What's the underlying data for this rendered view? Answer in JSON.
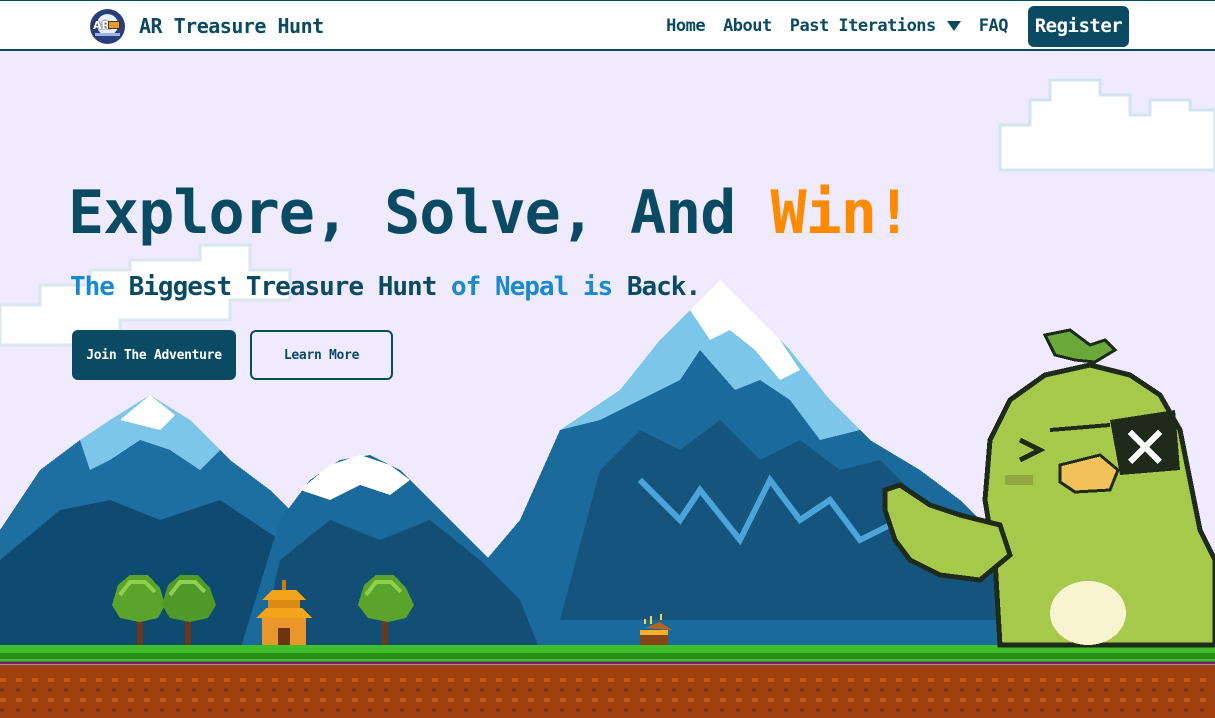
{
  "brand": {
    "name": "AR Treasure Hunt",
    "logo_text": "AR",
    "logo_icon": "treasure-chest-logo"
  },
  "nav": {
    "items": [
      {
        "label": "Home"
      },
      {
        "label": "About"
      },
      {
        "label": "Past Iterations",
        "icon": "chevron-down-icon"
      },
      {
        "label": "FAQ"
      }
    ],
    "register_label": "Register"
  },
  "hero": {
    "title_main": "Explore, Solve, And ",
    "title_accent": "Win!",
    "subtitle_parts": [
      "The",
      " Biggest Treasure Hunt ",
      "of Nepal is",
      " Back."
    ],
    "primary_button": "Join The Adventure",
    "secondary_button": "Learn More"
  },
  "colors": {
    "brand_navy": "#0a4a63",
    "accent_orange": "#ff8a00",
    "accent_blue": "#1a8ad0",
    "sky": "#efeafd",
    "grass": "#3fc02a",
    "dirt": "#a0400f"
  }
}
